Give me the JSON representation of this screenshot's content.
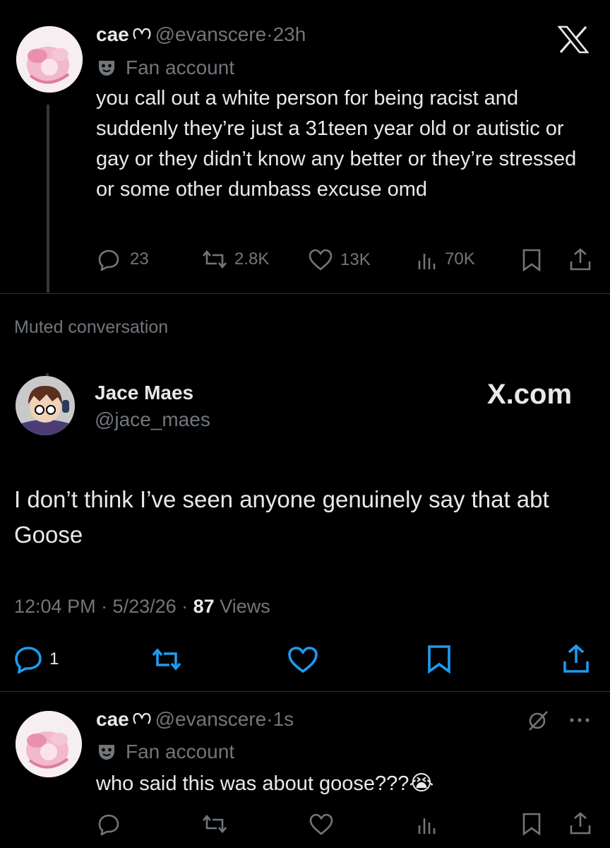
{
  "tweet1": {
    "display_name": "cae",
    "handle": "@evanscere",
    "time": "23h",
    "label": "Fan account",
    "text": "you call out a white person for being racist and suddenly they’re just a 31teen year old or autistic or gay or they didn’t know any better or they’re stressed or some other dumbass excuse omd",
    "stats": {
      "replies": "23",
      "reposts": "2.8K",
      "likes": "13K",
      "views": "70K"
    }
  },
  "muted_label": "Muted conversation",
  "main_tweet": {
    "display_name": "Jace Maes",
    "handle": "@jace_maes",
    "watermark": "X.com",
    "text": "I don’t think I’ve seen anyone genuinely say that abt Goose",
    "timestamp": "12:04 PM · 5/23/26 · ",
    "views_count": "87",
    "views_label": " Views",
    "reply_count": "1"
  },
  "reply": {
    "display_name": "cae",
    "handle": "@evanscere",
    "time": "1s",
    "label": "Fan account",
    "text": "who said this was about goose???",
    "emoji": "😭"
  },
  "icons": [
    "x-logo-icon",
    "mask-icon",
    "reply-icon",
    "repost-icon",
    "like-icon",
    "views-icon",
    "bookmark-icon",
    "share-icon",
    "more-icon",
    "mute-icon",
    "heart-outline-icon"
  ]
}
